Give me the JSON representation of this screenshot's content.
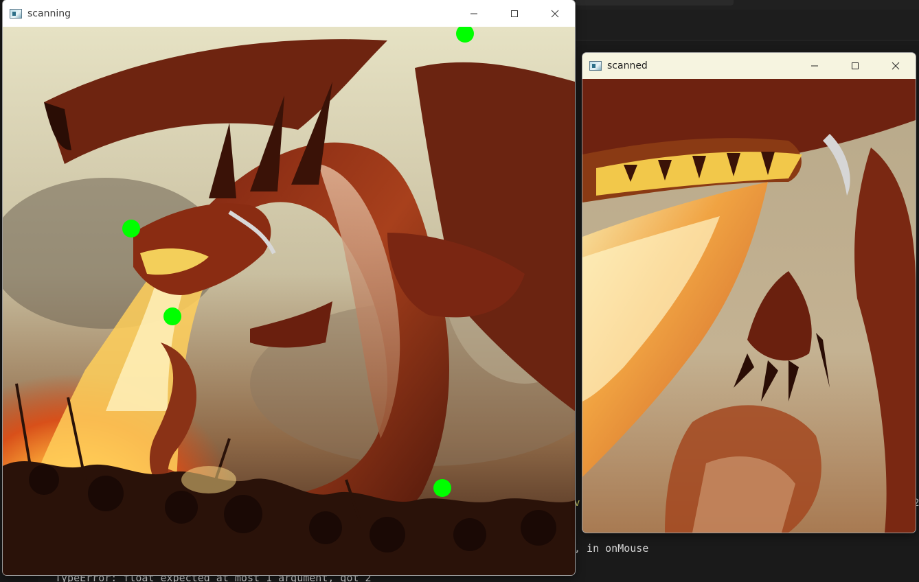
{
  "windows": {
    "scanning": {
      "title": "scanning",
      "corner_points_count": 4
    },
    "scanned": {
      "title": "scanned"
    }
  },
  "controls": {
    "minimize_icon": "minimize-icon",
    "maximize_icon": "maximize-icon",
    "close_icon": "close-icon"
  },
  "terminal": {
    "line_on_mouse": ", in onMouse",
    "line_error": "TypeError: float expected at most 1 argument, got 2",
    "fragment_v": "v",
    "fragment_2": "2"
  },
  "colors": {
    "corner_point": "#00ff00",
    "scanned_titlebar": "#f6f4e0",
    "terminal_bg": "#1a1a1a"
  }
}
